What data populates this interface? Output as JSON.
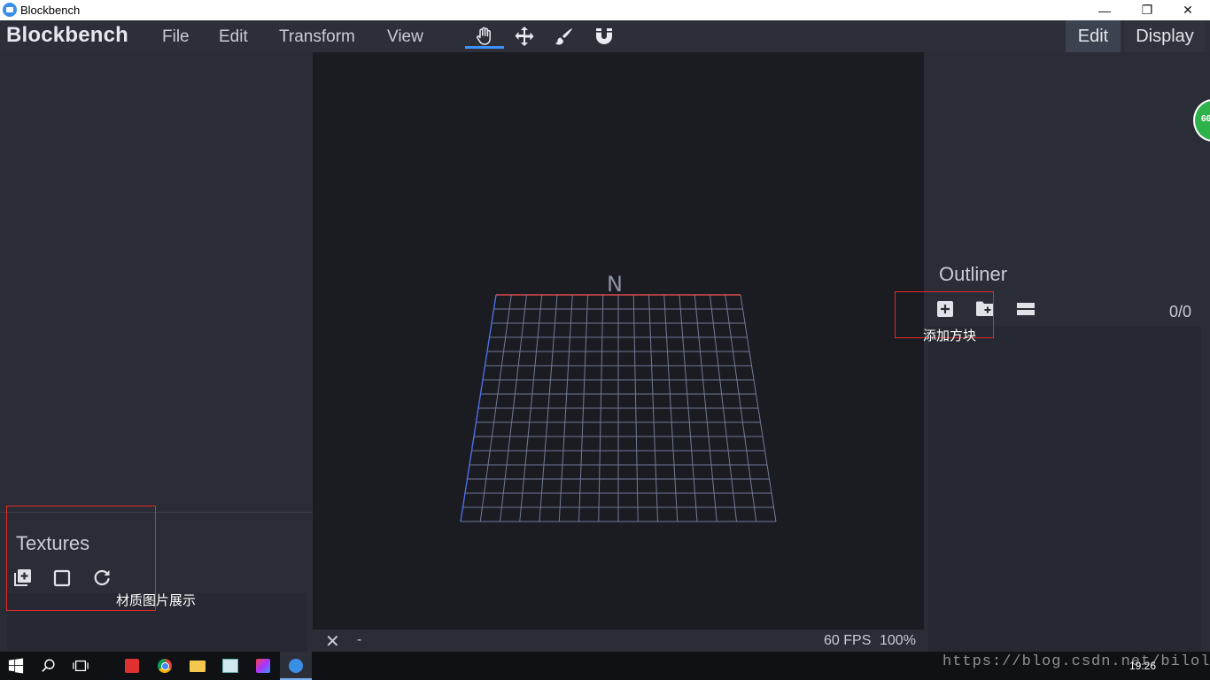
{
  "window": {
    "title": "Blockbench",
    "minimize_glyph": "—",
    "restore_glyph": "❐",
    "close_glyph": "✕"
  },
  "menubar": {
    "brand": "Blockbench",
    "items": [
      {
        "label": "File"
      },
      {
        "label": "Edit"
      },
      {
        "label": "Transform"
      },
      {
        "label": "View"
      }
    ],
    "tools": [
      {
        "icon": "hand-icon",
        "active": true
      },
      {
        "icon": "move-icon",
        "active": false
      },
      {
        "icon": "paint-brush-icon",
        "active": false
      },
      {
        "icon": "magnet-icon",
        "active": false
      }
    ],
    "modes": {
      "edit": "Edit",
      "display": "Display"
    }
  },
  "left_panel": {
    "textures": {
      "title": "Textures",
      "buttons": [
        "add-texture-icon",
        "blank-texture-icon",
        "reload-icon"
      ]
    },
    "annotation": "材质图片展示"
  },
  "viewport": {
    "compass": "N",
    "status": {
      "close_glyph": "✕",
      "selection": "-",
      "fps": "60 FPS",
      "zoom": "100%"
    }
  },
  "right_panel": {
    "outliner": {
      "title": "Outliner",
      "count": "0/0",
      "buttons": [
        "add-cube-icon",
        "add-group-icon",
        "collapse-all-icon"
      ]
    },
    "annotation": "添加方块",
    "badge": "66"
  },
  "taskbar": {
    "watermark": "https://blog.csdn.net/bilolxj",
    "clock": "19:26"
  },
  "colors": {
    "accent": "#3e90ff",
    "annotation_red": "#e02b2b",
    "grid": "#6f7a96",
    "grid_x_axis": "#e54b4b",
    "grid_z_axis": "#4b6ee5"
  }
}
